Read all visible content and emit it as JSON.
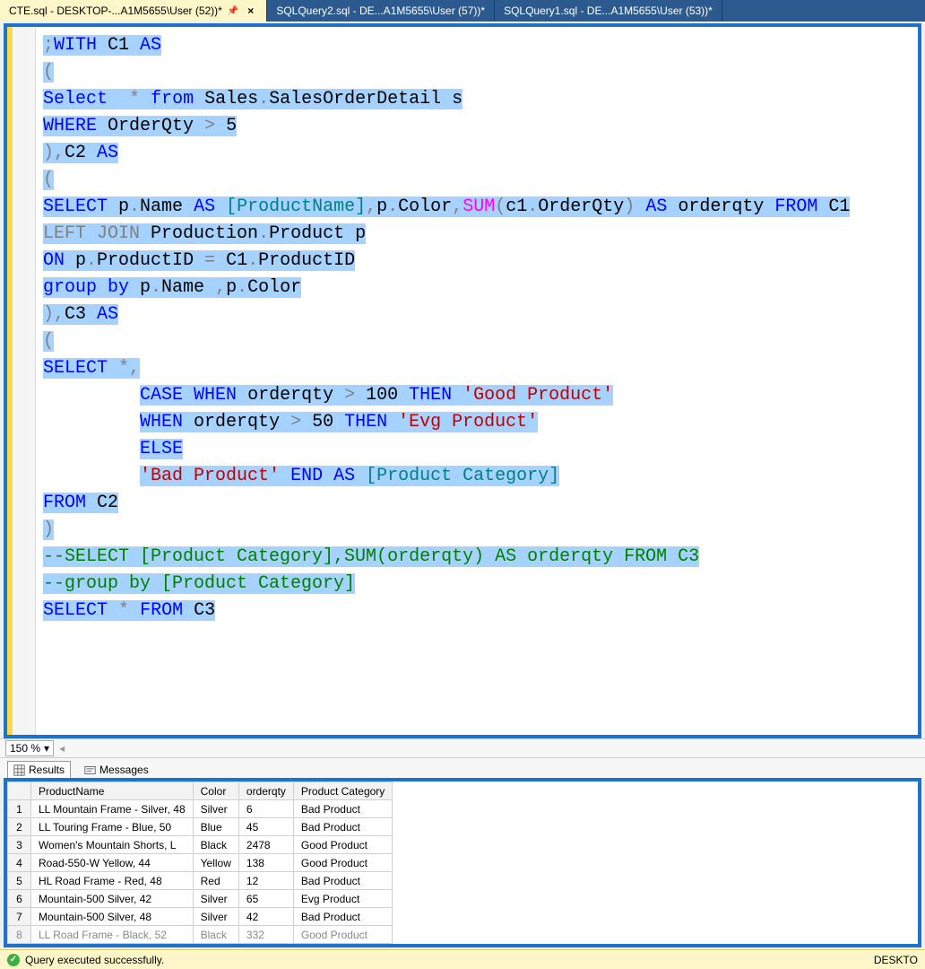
{
  "tabs": [
    {
      "label": "CTE.sql - DESKTOP-...A1M5655\\User (52))*",
      "active": true,
      "closable": true
    },
    {
      "label": "SQLQuery2.sql - DE...A1M5655\\User (57))*",
      "active": false,
      "closable": false
    },
    {
      "label": "SQLQuery1.sql - DE...A1M5655\\User (53))*",
      "active": false,
      "closable": false
    }
  ],
  "zoom": "150 %",
  "results_tabs": {
    "results": "Results",
    "messages": "Messages"
  },
  "grid": {
    "columns": [
      "ProductName",
      "Color",
      "orderqty",
      "Product Category"
    ],
    "rows": [
      [
        "1",
        "LL Mountain Frame - Silver, 48",
        "Silver",
        "6",
        "Bad Product"
      ],
      [
        "2",
        "LL Touring Frame - Blue, 50",
        "Blue",
        "45",
        "Bad Product"
      ],
      [
        "3",
        "Women's Mountain Shorts, L",
        "Black",
        "2478",
        "Good Product"
      ],
      [
        "4",
        "Road-550-W Yellow, 44",
        "Yellow",
        "138",
        "Good Product"
      ],
      [
        "5",
        "HL Road Frame - Red, 48",
        "Red",
        "12",
        "Bad Product"
      ],
      [
        "6",
        "Mountain-500 Silver, 42",
        "Silver",
        "65",
        "Evg Product"
      ],
      [
        "7",
        "Mountain-500 Silver, 48",
        "Silver",
        "42",
        "Bad Product"
      ],
      [
        "8",
        "LL Road Frame - Black, 52",
        "Black",
        "332",
        "Good Product"
      ]
    ]
  },
  "status": {
    "message": "Query executed successfully.",
    "right": "DESKTO"
  },
  "code_tokens": [
    [
      [
        "gray",
        ";",
        "s"
      ],
      [
        "blue",
        "WITH",
        "s"
      ],
      [
        "black",
        " C1 ",
        "s"
      ],
      [
        "blue",
        "AS",
        "s"
      ]
    ],
    [
      [
        "gray",
        "(",
        "s"
      ]
    ],
    [
      [
        "blue",
        "Select",
        "s"
      ],
      [
        "black",
        "  ",
        "s"
      ],
      [
        "gray",
        "*",
        "s"
      ],
      [
        "black",
        " ",
        "s"
      ],
      [
        "blue",
        "from",
        "s"
      ],
      [
        "black",
        " Sales",
        "s"
      ],
      [
        "gray",
        ".",
        "s"
      ],
      [
        "black",
        "SalesOrderDetail s",
        "s"
      ]
    ],
    [
      [
        "blue",
        "WHERE",
        "s"
      ],
      [
        "black",
        " OrderQty ",
        "s"
      ],
      [
        "gray",
        ">",
        "s"
      ],
      [
        "black",
        " 5",
        "s"
      ]
    ],
    [
      [
        "gray",
        ")",
        "s"
      ],
      [
        "gray",
        ",",
        "s"
      ],
      [
        "black",
        "C2 ",
        "s"
      ],
      [
        "blue",
        "AS",
        "s"
      ]
    ],
    [
      [
        "gray",
        "(",
        "s"
      ]
    ],
    [
      [
        "blue",
        "SELECT",
        "s"
      ],
      [
        "black",
        " p",
        "s"
      ],
      [
        "gray",
        ".",
        "s"
      ],
      [
        "black",
        "Name ",
        "s"
      ],
      [
        "blue",
        "AS",
        "s"
      ],
      [
        "black",
        " ",
        "s"
      ],
      [
        "teal",
        "[ProductName]",
        "s"
      ],
      [
        "gray",
        ",",
        "s"
      ],
      [
        "black",
        "p",
        "s"
      ],
      [
        "gray",
        ".",
        "s"
      ],
      [
        "black",
        "Color",
        "s"
      ],
      [
        "gray",
        ",",
        "s"
      ],
      [
        "pink",
        "SUM",
        "s"
      ],
      [
        "gray",
        "(",
        "s"
      ],
      [
        "black",
        "c1",
        "s"
      ],
      [
        "gray",
        ".",
        "s"
      ],
      [
        "black",
        "OrderQty",
        "s"
      ],
      [
        "gray",
        ")",
        "s"
      ],
      [
        "black",
        " ",
        "s"
      ],
      [
        "blue",
        "AS",
        "s"
      ],
      [
        "black",
        " orderqty ",
        "s"
      ],
      [
        "blue",
        "FROM",
        "s"
      ],
      [
        "black",
        " C1",
        "s"
      ]
    ],
    [
      [
        "gray",
        "LEFT JOIN",
        "s"
      ],
      [
        "black",
        " Production",
        "s"
      ],
      [
        "gray",
        ".",
        "s"
      ],
      [
        "black",
        "Product p",
        "s"
      ]
    ],
    [
      [
        "blue",
        "ON",
        "s"
      ],
      [
        "black",
        " p",
        "s"
      ],
      [
        "gray",
        ".",
        "s"
      ],
      [
        "black",
        "ProductID ",
        "s"
      ],
      [
        "gray",
        "=",
        "s"
      ],
      [
        "black",
        " C1",
        "s"
      ],
      [
        "gray",
        ".",
        "s"
      ],
      [
        "black",
        "ProductID",
        "s"
      ]
    ],
    [
      [
        "blue",
        "group by",
        "s"
      ],
      [
        "black",
        " p",
        "s"
      ],
      [
        "gray",
        ".",
        "s"
      ],
      [
        "black",
        "Name ",
        "s"
      ],
      [
        "gray",
        ",",
        "s"
      ],
      [
        "black",
        "p",
        "s"
      ],
      [
        "gray",
        ".",
        "s"
      ],
      [
        "black",
        "Color",
        "s"
      ]
    ],
    [
      [
        "gray",
        ")",
        "s"
      ],
      [
        "gray",
        ",",
        "s"
      ],
      [
        "black",
        "C3 ",
        "s"
      ],
      [
        "blue",
        "AS",
        "s"
      ]
    ],
    [
      [
        "gray",
        "(",
        "s"
      ]
    ],
    [
      [
        "blue",
        "SELECT",
        "s"
      ],
      [
        "black",
        " ",
        "s"
      ],
      [
        "gray",
        "*",
        "s"
      ],
      [
        "gray",
        ",",
        "s"
      ]
    ],
    [
      [
        "black",
        "         ",
        ""
      ],
      [
        "blue",
        "CASE WHEN",
        "s"
      ],
      [
        "black",
        " orderqty ",
        "s"
      ],
      [
        "gray",
        ">",
        "s"
      ],
      [
        "black",
        " 100 ",
        "s"
      ],
      [
        "blue",
        "THEN",
        "s"
      ],
      [
        "black",
        " ",
        "s"
      ],
      [
        "red",
        "'Good Product'",
        "s"
      ]
    ],
    [
      [
        "black",
        "         ",
        ""
      ],
      [
        "blue",
        "WHEN",
        "s"
      ],
      [
        "black",
        " orderqty ",
        "s"
      ],
      [
        "gray",
        ">",
        "s"
      ],
      [
        "black",
        " 50 ",
        "s"
      ],
      [
        "blue",
        "THEN",
        "s"
      ],
      [
        "black",
        " ",
        "s"
      ],
      [
        "red",
        "'Evg Product'",
        "s"
      ]
    ],
    [
      [
        "black",
        "         ",
        ""
      ],
      [
        "blue",
        "ELSE",
        "s"
      ]
    ],
    [
      [
        "black",
        "         ",
        ""
      ],
      [
        "red",
        "'Bad Product'",
        "s"
      ],
      [
        "black",
        " ",
        "s"
      ],
      [
        "blue",
        "END AS",
        "s"
      ],
      [
        "black",
        " ",
        "s"
      ],
      [
        "teal",
        "[Product Category]",
        "s"
      ]
    ],
    [
      [
        "blue",
        "FROM",
        "s"
      ],
      [
        "black",
        " C2",
        "s"
      ]
    ],
    [
      [
        "gray",
        ")",
        "s"
      ]
    ],
    [
      [
        "green",
        "--SELECT [Product Category],SUM(orderqty) AS orderqty FROM C3",
        "s"
      ]
    ],
    [
      [
        "green",
        "--group by [Product Category]",
        "s"
      ]
    ],
    [
      [
        "blue",
        "SELECT",
        "s"
      ],
      [
        "black",
        " ",
        "s"
      ],
      [
        "gray",
        "*",
        "s"
      ],
      [
        "black",
        " ",
        "s"
      ],
      [
        "blue",
        "FROM",
        "s"
      ],
      [
        "black",
        " C3",
        "s"
      ]
    ]
  ]
}
